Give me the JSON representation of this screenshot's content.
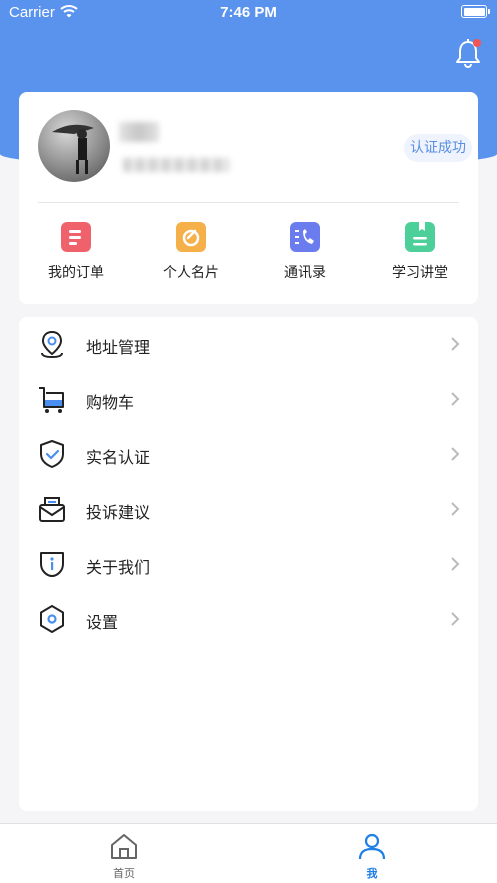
{
  "status_bar": {
    "carrier": "Carrier",
    "time": "7:46 PM"
  },
  "profile": {
    "verified_badge": "认证成功"
  },
  "quick_actions": [
    {
      "label": "我的订单",
      "icon": "order-icon",
      "color": "#f0626b"
    },
    {
      "label": "个人名片",
      "icon": "business-card-icon",
      "color": "#f6b04a"
    },
    {
      "label": "通讯录",
      "icon": "contacts-icon",
      "color": "#6b7cef"
    },
    {
      "label": "学习讲堂",
      "icon": "study-book-icon",
      "color": "#4ccf98"
    }
  ],
  "menu": [
    {
      "label": "地址管理",
      "icon": "location-pin-icon"
    },
    {
      "label": "购物车",
      "icon": "shopping-cart-icon"
    },
    {
      "label": "实名认证",
      "icon": "shield-check-icon"
    },
    {
      "label": "投诉建议",
      "icon": "mail-icon"
    },
    {
      "label": "关于我们",
      "icon": "info-icon"
    },
    {
      "label": "设置",
      "icon": "settings-hex-icon"
    }
  ],
  "tabbar": [
    {
      "label": "首页",
      "icon": "home-icon",
      "active": false
    },
    {
      "label": "我",
      "icon": "person-icon",
      "active": true
    }
  ],
  "colors": {
    "primary": "#5a93ee",
    "active_tab": "#1e7fe6",
    "inactive_tab": "#666666"
  }
}
